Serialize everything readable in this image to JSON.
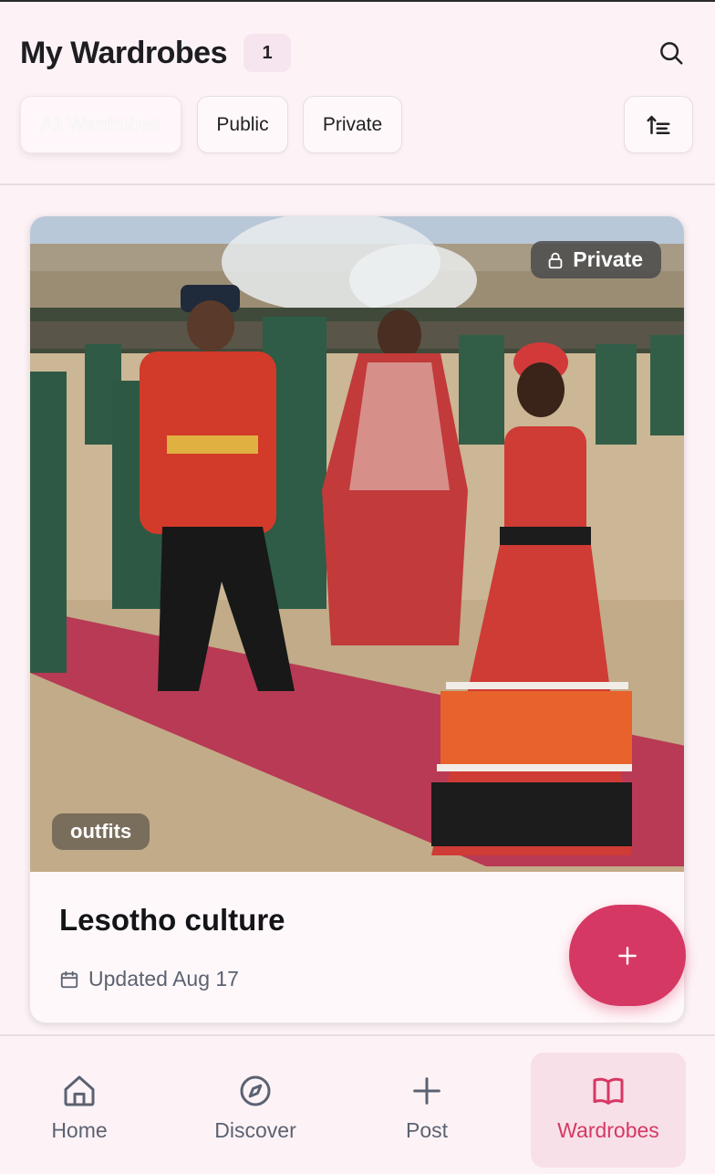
{
  "header": {
    "title": "My Wardrobes",
    "count": "1"
  },
  "filters": [
    {
      "label": "All Wardrobes",
      "active": true
    },
    {
      "label": "Public",
      "active": false
    },
    {
      "label": "Private",
      "active": false
    }
  ],
  "card": {
    "visibility": "Private",
    "tag": "outfits",
    "title": "Lesotho culture",
    "updated": "Updated Aug 17"
  },
  "nav": {
    "home": "Home",
    "discover": "Discover",
    "post": "Post",
    "wardrobes": "Wardrobes"
  },
  "colors": {
    "accent": "#d63864",
    "muted": "#5b6272"
  },
  "icons": [
    "search-icon",
    "sort-icon",
    "lock-icon",
    "calendar-icon",
    "plus-icon",
    "home-icon",
    "compass-icon",
    "book-icon"
  ]
}
